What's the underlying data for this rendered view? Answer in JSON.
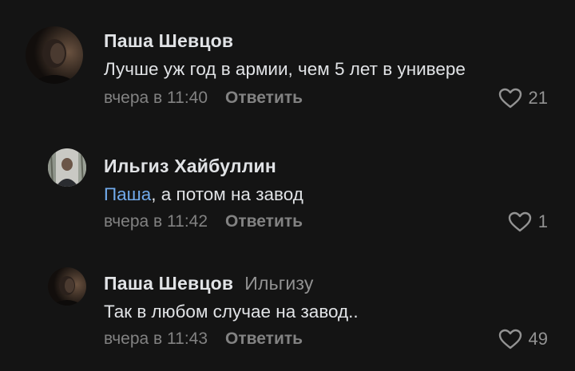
{
  "comments": [
    {
      "author": "Паша Шевцов",
      "text": "Лучше уж год в армии, чем 5 лет в универе",
      "time": "вчера в 11:40",
      "reply_label": "Ответить",
      "likes": "21",
      "avatar_icon": "user-photo"
    },
    {
      "author": "Ильгиз Хайбуллин",
      "mention": "Паша",
      "text": ", а потом на завод",
      "time": "вчера в 11:42",
      "reply_label": "Ответить",
      "likes": "1",
      "avatar_icon": "user-photo"
    },
    {
      "author": "Паша Шевцов",
      "reply_to": "Ильгизу",
      "text": "Так в любом случае на завод..",
      "time": "вчера в 11:43",
      "reply_label": "Ответить",
      "likes": "49",
      "avatar_icon": "user-photo"
    }
  ],
  "colors": {
    "background": "#141414",
    "text": "#e1e3e6",
    "secondary": "#828282",
    "link": "#71aaeb"
  },
  "icons": {
    "like": "heart-outline-icon"
  }
}
